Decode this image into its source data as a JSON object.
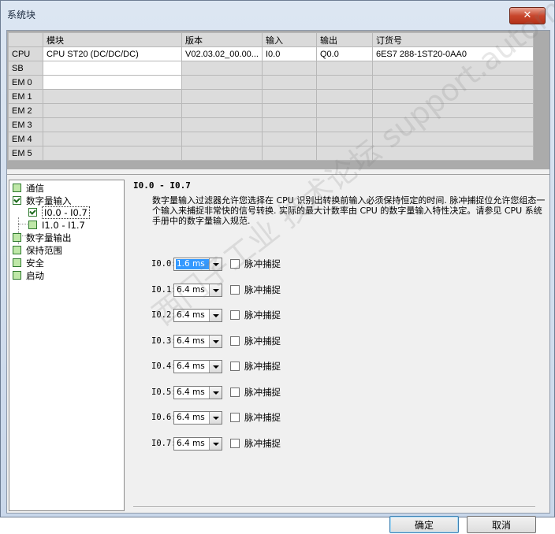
{
  "window": {
    "title": "系统块",
    "close_icon": "close-icon"
  },
  "grid": {
    "headers": [
      "",
      "模块",
      "版本",
      "输入",
      "输出",
      "订货号"
    ],
    "rows": [
      [
        "CPU",
        "CPU ST20 (DC/DC/DC)",
        "V02.03.02_00.00...",
        "I0.0",
        "Q0.0",
        "6ES7 288-1ST20-0AA0"
      ],
      [
        "SB",
        "",
        "",
        "",
        "",
        ""
      ],
      [
        "EM 0",
        "",
        "",
        "",
        "",
        ""
      ],
      [
        "EM 1",
        "",
        "",
        "",
        "",
        ""
      ],
      [
        "EM 2",
        "",
        "",
        "",
        "",
        ""
      ],
      [
        "EM 3",
        "",
        "",
        "",
        "",
        ""
      ],
      [
        "EM 4",
        "",
        "",
        "",
        "",
        ""
      ],
      [
        "EM 5",
        "",
        "",
        "",
        "",
        ""
      ]
    ]
  },
  "tree": {
    "items": [
      {
        "label": "通信"
      },
      {
        "label": "数字量输入"
      },
      {
        "label": "I0.0 - I0.7"
      },
      {
        "label": "I1.0 - I1.7"
      },
      {
        "label": "数字量输出"
      },
      {
        "label": "保持范围"
      },
      {
        "label": "安全"
      },
      {
        "label": "启动"
      }
    ]
  },
  "panel": {
    "heading": "I0.0 - I0.7",
    "description": "数字量输入过滤器允许您选择在 CPU 识别出转换前输入必须保持恒定的时间. 脉冲捕捉位允许您组态一个输入来捕捉非常快的信号转换. 实际的最大计数率由 CPU 的数字量输入特性决定。请参见 CPU 系统手册中的数字量输入规范.",
    "inputs": [
      {
        "label": "I0.0:",
        "value": "1.6 ms",
        "pulse": "脉冲捕捉"
      },
      {
        "label": "I0.1:",
        "value": "6.4 ms",
        "pulse": "脉冲捕捉"
      },
      {
        "label": "I0.2:",
        "value": "6.4 ms",
        "pulse": "脉冲捕捉"
      },
      {
        "label": "I0.3:",
        "value": "6.4 ms",
        "pulse": "脉冲捕捉"
      },
      {
        "label": "I0.4:",
        "value": "6.4 ms",
        "pulse": "脉冲捕捉"
      },
      {
        "label": "I0.5:",
        "value": "6.4 ms",
        "pulse": "脉冲捕捉"
      },
      {
        "label": "I0.6:",
        "value": "6.4 ms",
        "pulse": "脉冲捕捉"
      },
      {
        "label": "I0.7:",
        "value": "6.4 ms",
        "pulse": "脉冲捕捉"
      }
    ]
  },
  "buttons": {
    "ok": "确定",
    "cancel": "取消"
  },
  "watermark": "西门子工业 技术论坛 support.automation.siemens.com",
  "colors": {
    "selection": "#3399ff",
    "checkbox_green": "#bfe8a8",
    "close_red": "#c8462c"
  }
}
